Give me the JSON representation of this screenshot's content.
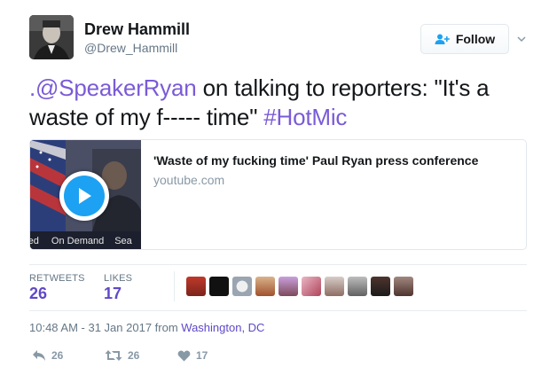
{
  "user": {
    "display_name": "Drew Hammill",
    "handle": "@Drew_Hammill"
  },
  "follow_button": {
    "label": "Follow",
    "icon": "add-user-icon"
  },
  "tweet": {
    "mention": ".@SpeakerRyan",
    "text_a": " on talking to reporters: \"It's a waste of my f----- time\" ",
    "hashtag": "#HotMic"
  },
  "card": {
    "title": "'Waste of my fucking time' Paul Ryan press conference",
    "domain": "youtube.com",
    "thumb_strip": [
      "red",
      "On Demand",
      "Sea"
    ]
  },
  "stats": {
    "retweets_label": "RETWEETS",
    "retweets_value": "26",
    "likes_label": "LIKES",
    "likes_value": "17"
  },
  "timestamp": {
    "time": "10:48 AM - 31 Jan 2017 from ",
    "location": "Washington, DC"
  },
  "actions": {
    "reply_count": "26",
    "retweet_count": "26",
    "like_count": "17"
  },
  "colors": {
    "link": "#7a5bd6",
    "accent": "#5f48c8",
    "muted": "#8899a6"
  }
}
